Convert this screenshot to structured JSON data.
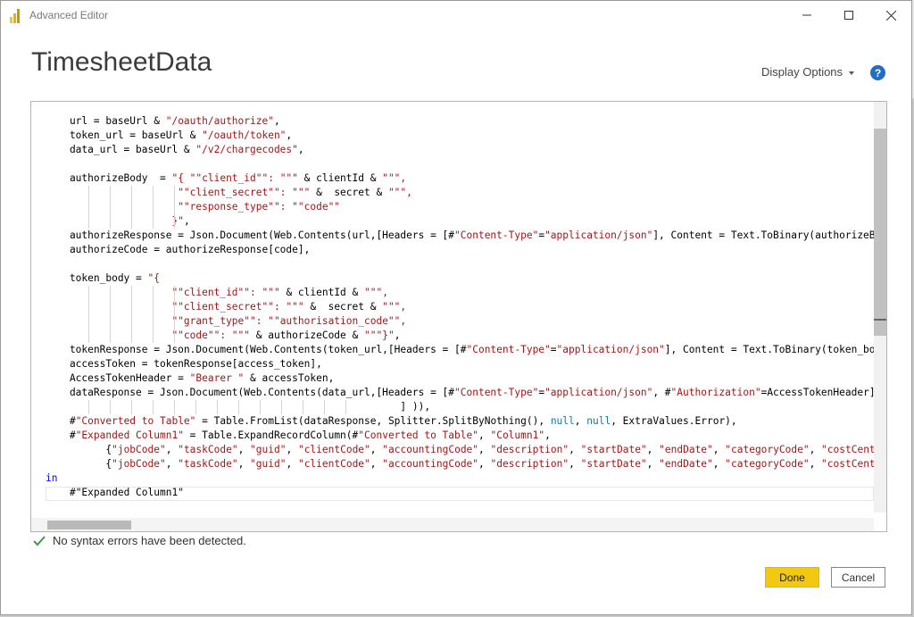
{
  "window": {
    "title": "Advanced Editor",
    "query_name": "TimesheetData"
  },
  "toolbar": {
    "display_options_label": "Display Options",
    "help_label": "?"
  },
  "status": {
    "message": "No syntax errors have been detected."
  },
  "buttons": {
    "done": "Done",
    "cancel": "Cancel"
  },
  "colors": {
    "string": "#a31515",
    "keyword": "#0000ff",
    "null_literal": "#1a7a9a",
    "done_button": "#f2c811",
    "check": "#3c9a4a",
    "help": "#1f6fc2"
  },
  "icons": {
    "app": "power-bi-icon",
    "minimize": "minimize-icon",
    "maximize": "maximize-icon",
    "close": "close-icon",
    "help": "help-icon",
    "status": "checkmark-icon"
  },
  "code_lines": [
    {
      "indent": 16,
      "guides": [],
      "tokens": [
        {
          "t": "    url = baseUrl & ",
          "c": "default"
        },
        {
          "t": "\"/oauth/authorize\"",
          "c": "string"
        },
        {
          "t": ",",
          "c": "default"
        }
      ]
    },
    {
      "indent": 16,
      "guides": [],
      "tokens": [
        {
          "t": "    token_url = baseUrl & ",
          "c": "default"
        },
        {
          "t": "\"/oauth/token\"",
          "c": "string"
        },
        {
          "t": ",",
          "c": "default"
        }
      ]
    },
    {
      "indent": 16,
      "guides": [],
      "tokens": [
        {
          "t": "    data_url = baseUrl & ",
          "c": "default"
        },
        {
          "t": "\"/v2/chargecodes\"",
          "c": "string"
        },
        {
          "t": ",",
          "c": "default"
        }
      ]
    },
    {
      "indent": 16,
      "guides": [],
      "tokens": [
        {
          "t": "",
          "c": "default"
        }
      ]
    },
    {
      "indent": 16,
      "guides": [],
      "tokens": [
        {
          "t": "    authorizeBody  = ",
          "c": "default"
        },
        {
          "t": "\"{ \"\"client_id\"\": \"\"\"",
          "c": "string"
        },
        {
          "t": " & clientId & ",
          "c": "default"
        },
        {
          "t": "\"\"\",",
          "c": "string"
        }
      ]
    },
    {
      "indent": 16,
      "guides": [
        48,
        72,
        96,
        120,
        144
      ],
      "tokens": [
        {
          "t": "                      ",
          "c": "default"
        },
        {
          "t": "\"\"client_secret\"\": \"\"\"",
          "c": "string"
        },
        {
          "t": " &  secret & ",
          "c": "default"
        },
        {
          "t": "\"\"\",",
          "c": "string"
        }
      ]
    },
    {
      "indent": 16,
      "guides": [
        48,
        72,
        96,
        120,
        144
      ],
      "tokens": [
        {
          "t": "                      ",
          "c": "default"
        },
        {
          "t": "\"\"response_type\"\": \"\"code\"\"",
          "c": "string"
        }
      ]
    },
    {
      "indent": 16,
      "guides": [
        48,
        72,
        96,
        120,
        144
      ],
      "tokens": [
        {
          "t": "                     ",
          "c": "default"
        },
        {
          "t": "}\"",
          "c": "string"
        },
        {
          "t": ",",
          "c": "default"
        }
      ]
    },
    {
      "indent": 16,
      "guides": [],
      "tokens": [
        {
          "t": "    authorizeResponse = Json.Document(Web.Contents(url,[Headers = [#",
          "c": "default"
        },
        {
          "t": "\"Content-Type\"",
          "c": "string"
        },
        {
          "t": "=",
          "c": "default"
        },
        {
          "t": "\"application/json\"",
          "c": "string"
        },
        {
          "t": "], Content = Text.ToBinary(authorizeBody) ]",
          "c": "default"
        }
      ]
    },
    {
      "indent": 16,
      "guides": [],
      "tokens": [
        {
          "t": "    authorizeCode = authorizeResponse[code],",
          "c": "default"
        }
      ]
    },
    {
      "indent": 16,
      "guides": [],
      "tokens": [
        {
          "t": "",
          "c": "default"
        }
      ]
    },
    {
      "indent": 16,
      "guides": [],
      "tokens": [
        {
          "t": "    token_body = ",
          "c": "default"
        },
        {
          "t": "\"{",
          "c": "string"
        }
      ]
    },
    {
      "indent": 16,
      "guides": [
        48,
        72,
        96,
        120,
        144
      ],
      "tokens": [
        {
          "t": "                     ",
          "c": "default"
        },
        {
          "t": "\"\"client_id\"\": \"\"\"",
          "c": "string"
        },
        {
          "t": " & clientId & ",
          "c": "default"
        },
        {
          "t": "\"\"\",",
          "c": "string"
        }
      ]
    },
    {
      "indent": 16,
      "guides": [
        48,
        72,
        96,
        120,
        144
      ],
      "tokens": [
        {
          "t": "                     ",
          "c": "default"
        },
        {
          "t": "\"\"client_secret\"\": \"\"\"",
          "c": "string"
        },
        {
          "t": " &  secret & ",
          "c": "default"
        },
        {
          "t": "\"\"\",",
          "c": "string"
        }
      ]
    },
    {
      "indent": 16,
      "guides": [
        48,
        72,
        96,
        120,
        144
      ],
      "tokens": [
        {
          "t": "                     ",
          "c": "default"
        },
        {
          "t": "\"\"grant_type\"\": \"\"authorisation_code\"\",",
          "c": "string"
        }
      ]
    },
    {
      "indent": 16,
      "guides": [
        48,
        72,
        96,
        120,
        144
      ],
      "tokens": [
        {
          "t": "                     ",
          "c": "default"
        },
        {
          "t": "\"\"code\"\": \"\"\"",
          "c": "string"
        },
        {
          "t": " & authorizeCode & ",
          "c": "default"
        },
        {
          "t": "\"\"\"}\"",
          "c": "string"
        },
        {
          "t": ",",
          "c": "default"
        }
      ]
    },
    {
      "indent": 16,
      "guides": [],
      "tokens": [
        {
          "t": "    tokenResponse = Json.Document(Web.Contents(token_url,[Headers = [#",
          "c": "default"
        },
        {
          "t": "\"Content-Type\"",
          "c": "string"
        },
        {
          "t": "=",
          "c": "default"
        },
        {
          "t": "\"application/json\"",
          "c": "string"
        },
        {
          "t": "], Content = Text.ToBinary(token_body) ]",
          "c": "default"
        }
      ]
    },
    {
      "indent": 16,
      "guides": [],
      "tokens": [
        {
          "t": "    accessToken = tokenResponse[access_token],",
          "c": "default"
        }
      ]
    },
    {
      "indent": 16,
      "guides": [],
      "tokens": [
        {
          "t": "    AccessTokenHeader = ",
          "c": "default"
        },
        {
          "t": "\"Bearer \"",
          "c": "string"
        },
        {
          "t": " & accessToken,",
          "c": "default"
        }
      ]
    },
    {
      "indent": 16,
      "guides": [],
      "tokens": [
        {
          "t": "    dataResponse = Json.Document(Web.Contents(data_url,[Headers = [#",
          "c": "default"
        },
        {
          "t": "\"Content-Type\"",
          "c": "string"
        },
        {
          "t": "=",
          "c": "default"
        },
        {
          "t": "\"application/json\"",
          "c": "string"
        },
        {
          "t": ", #",
          "c": "default"
        },
        {
          "t": "\"Authorization\"",
          "c": "string"
        },
        {
          "t": "=AccessTokenHeader]",
          "c": "default"
        }
      ]
    },
    {
      "indent": 16,
      "guides": [
        48,
        72,
        96,
        120,
        144,
        168,
        192,
        216,
        240,
        264,
        288,
        312,
        336
      ],
      "tokens": [
        {
          "t": "                                                           ] )),",
          "c": "default"
        }
      ]
    },
    {
      "indent": 16,
      "guides": [],
      "tokens": [
        {
          "t": "    #",
          "c": "default"
        },
        {
          "t": "\"Converted to Table\"",
          "c": "string"
        },
        {
          "t": " = Table.FromList(dataResponse, Splitter.SplitByNothing(), ",
          "c": "default"
        },
        {
          "t": "null",
          "c": "null"
        },
        {
          "t": ", ",
          "c": "default"
        },
        {
          "t": "null",
          "c": "null"
        },
        {
          "t": ", ExtraValues.Error),",
          "c": "default"
        }
      ]
    },
    {
      "indent": 16,
      "guides": [],
      "tokens": [
        {
          "t": "    #",
          "c": "default"
        },
        {
          "t": "\"Expanded Column1\"",
          "c": "string"
        },
        {
          "t": " = Table.ExpandRecordColumn(#",
          "c": "default"
        },
        {
          "t": "\"Converted to Table\"",
          "c": "string"
        },
        {
          "t": ", ",
          "c": "default"
        },
        {
          "t": "\"Column1\"",
          "c": "string"
        },
        {
          "t": ",",
          "c": "default"
        }
      ]
    },
    {
      "indent": 16,
      "guides": [],
      "tokens": [
        {
          "t": "          {",
          "c": "default"
        },
        {
          "t": "\"jobCode\"",
          "c": "string"
        },
        {
          "t": ", ",
          "c": "default"
        },
        {
          "t": "\"taskCode\"",
          "c": "string"
        },
        {
          "t": ", ",
          "c": "default"
        },
        {
          "t": "\"guid\"",
          "c": "string"
        },
        {
          "t": ", ",
          "c": "default"
        },
        {
          "t": "\"clientCode\"",
          "c": "string"
        },
        {
          "t": ", ",
          "c": "default"
        },
        {
          "t": "\"accountingCode\"",
          "c": "string"
        },
        {
          "t": ", ",
          "c": "default"
        },
        {
          "t": "\"description\"",
          "c": "string"
        },
        {
          "t": ", ",
          "c": "default"
        },
        {
          "t": "\"startDate\"",
          "c": "string"
        },
        {
          "t": ", ",
          "c": "default"
        },
        {
          "t": "\"endDate\"",
          "c": "string"
        },
        {
          "t": ", ",
          "c": "default"
        },
        {
          "t": "\"categoryCode\"",
          "c": "string"
        },
        {
          "t": ", ",
          "c": "default"
        },
        {
          "t": "\"costCentreCode\"",
          "c": "string"
        }
      ]
    },
    {
      "indent": 16,
      "guides": [],
      "tokens": [
        {
          "t": "          {",
          "c": "default"
        },
        {
          "t": "\"jobCode\"",
          "c": "string"
        },
        {
          "t": ", ",
          "c": "default"
        },
        {
          "t": "\"taskCode\"",
          "c": "string"
        },
        {
          "t": ", ",
          "c": "default"
        },
        {
          "t": "\"guid\"",
          "c": "string"
        },
        {
          "t": ", ",
          "c": "default"
        },
        {
          "t": "\"clientCode\"",
          "c": "string"
        },
        {
          "t": ", ",
          "c": "default"
        },
        {
          "t": "\"accountingCode\"",
          "c": "string"
        },
        {
          "t": ", ",
          "c": "default"
        },
        {
          "t": "\"description\"",
          "c": "string"
        },
        {
          "t": ", ",
          "c": "default"
        },
        {
          "t": "\"startDate\"",
          "c": "string"
        },
        {
          "t": ", ",
          "c": "default"
        },
        {
          "t": "\"endDate\"",
          "c": "string"
        },
        {
          "t": ", ",
          "c": "default"
        },
        {
          "t": "\"categoryCode\"",
          "c": "string"
        },
        {
          "t": ", ",
          "c": "default"
        },
        {
          "t": "\"costCentreCode\"",
          "c": "string"
        }
      ]
    },
    {
      "indent": 16,
      "guides": [],
      "tokens": [
        {
          "t": "in",
          "c": "keyword"
        }
      ]
    },
    {
      "indent": 16,
      "guides": [],
      "tokens": [
        {
          "t": "    #",
          "c": "default"
        },
        {
          "t": "\"Expanded Column1\"",
          "c": "default"
        }
      ]
    }
  ]
}
